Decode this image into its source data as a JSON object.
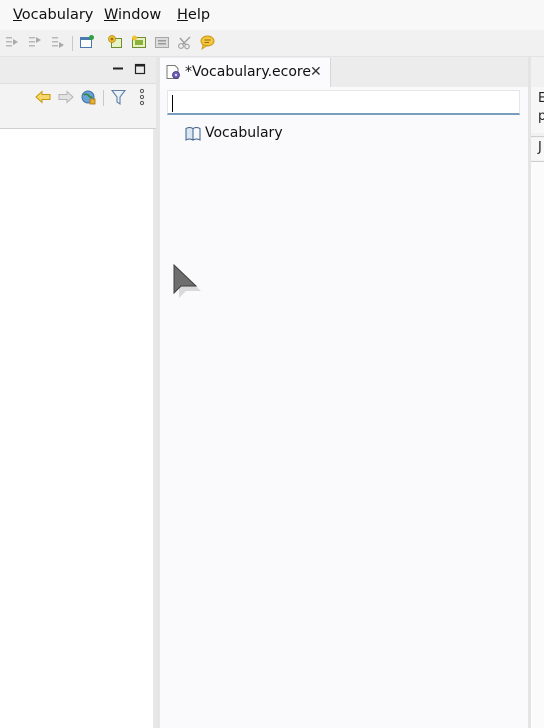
{
  "menu": {
    "items": [
      {
        "mnemonic": "V",
        "rest": "ocabulary"
      },
      {
        "mnemonic": "W",
        "rest": "indow"
      },
      {
        "mnemonic": "H",
        "rest": "elp"
      }
    ]
  },
  "icons": {
    "toolbar": [
      "step-into-icon",
      "step-over-icon",
      "step-return-icon",
      "new-diagram-icon",
      "add-child-icon",
      "add-sibling-icon",
      "new-file-icon",
      "cut-icon",
      "chat-icon"
    ],
    "left_toolbar": [
      "back-arrow-icon",
      "forward-arrow-icon",
      "link-with-editor-icon",
      "filter-icon",
      "view-menu-icon"
    ],
    "left_header": [
      "minimize-icon",
      "maximize-icon"
    ],
    "editor": [
      "ecore-file-icon",
      "close-icon",
      "package-icon",
      "mouse-cursor-icon"
    ]
  },
  "editor": {
    "tab_title": "*Vocabulary.ecore",
    "filter_value": "",
    "tree": [
      {
        "label": "Vocabulary"
      }
    ]
  },
  "right_panel": {
    "line1": "E",
    "line2": "p",
    "line3": "J"
  },
  "colors": {
    "filter_underline": "#7a9dbb",
    "editor_background": "#fafafd"
  }
}
